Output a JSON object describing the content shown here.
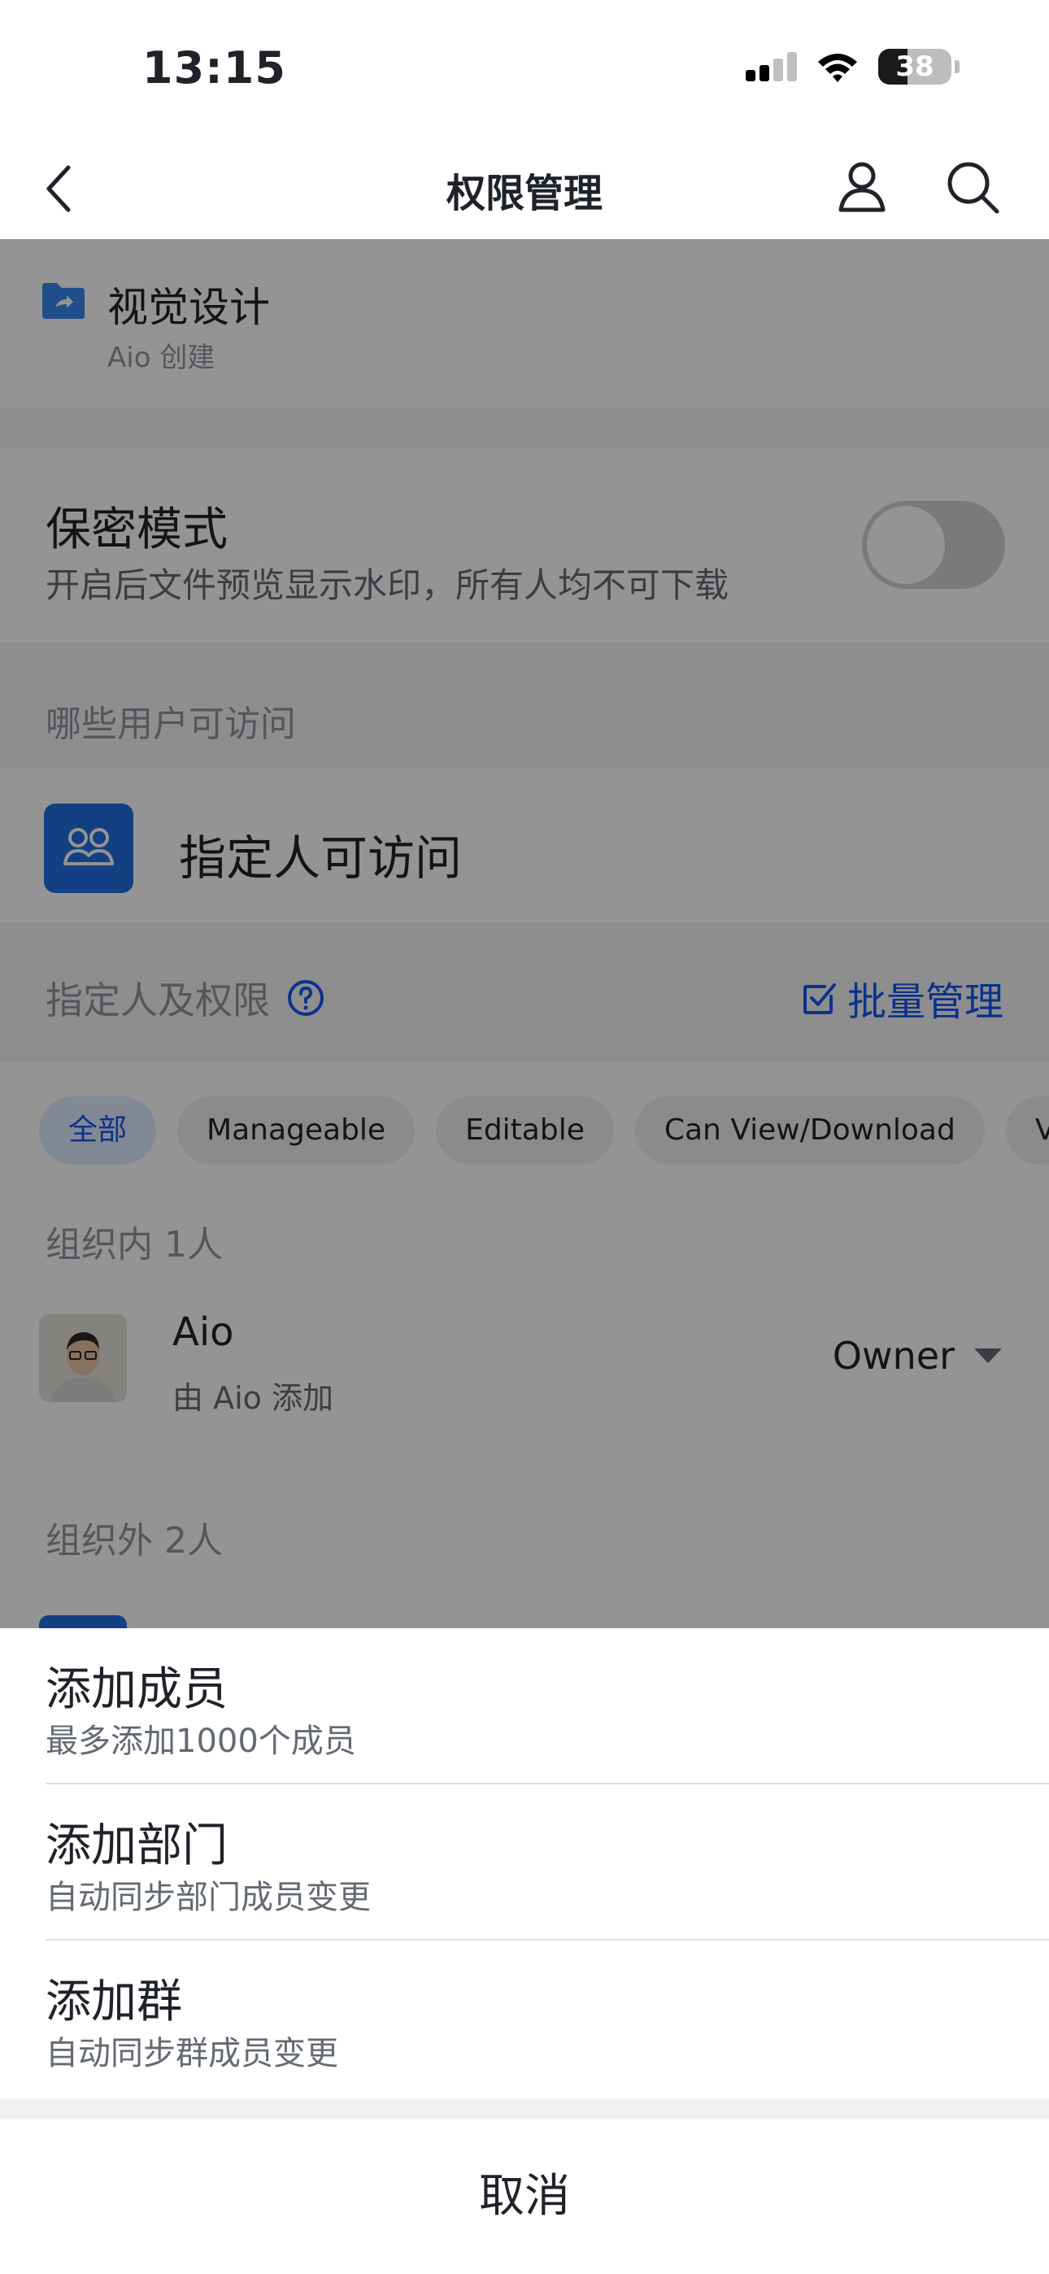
{
  "status_bar": {
    "time": "13:15",
    "battery": "38"
  },
  "nav": {
    "title": "权限管理"
  },
  "folder": {
    "name": "视觉设计",
    "creator": "Aio 创建"
  },
  "secret_mode": {
    "title": "保密模式",
    "desc": "开启后文件预览显示水印，所有人均不可下载",
    "enabled": false
  },
  "access": {
    "section_label": "哪些用户可访问",
    "label": "指定人可访问"
  },
  "permissions": {
    "label": "指定人及权限",
    "batch_label": "批量管理"
  },
  "filters": [
    "全部",
    "Manageable",
    "Editable",
    "Can View/Download",
    "View c"
  ],
  "groups": {
    "internal": "组织内 1人",
    "external": "组织外 2人"
  },
  "member": {
    "name": "Aio",
    "added_by": "由 Aio 添加",
    "role": "Owner"
  },
  "sheet": {
    "items": [
      {
        "title": "添加成员",
        "sub": "最多添加1000个成员"
      },
      {
        "title": "添加部门",
        "sub": "自动同步部门成员变更"
      },
      {
        "title": "添加群",
        "sub": "自动同步群成员变更"
      }
    ],
    "cancel": "取消"
  },
  "colors": {
    "accent": "#1456f0",
    "access_icon_bg": "#1f6fe0",
    "overlay": "rgba(0,0,0,0.42)"
  },
  "icons": [
    "back-icon",
    "person-icon",
    "search-icon",
    "folder-icon",
    "group-icon",
    "help-icon",
    "checkbox-icon",
    "dropdown-caret-icon"
  ]
}
